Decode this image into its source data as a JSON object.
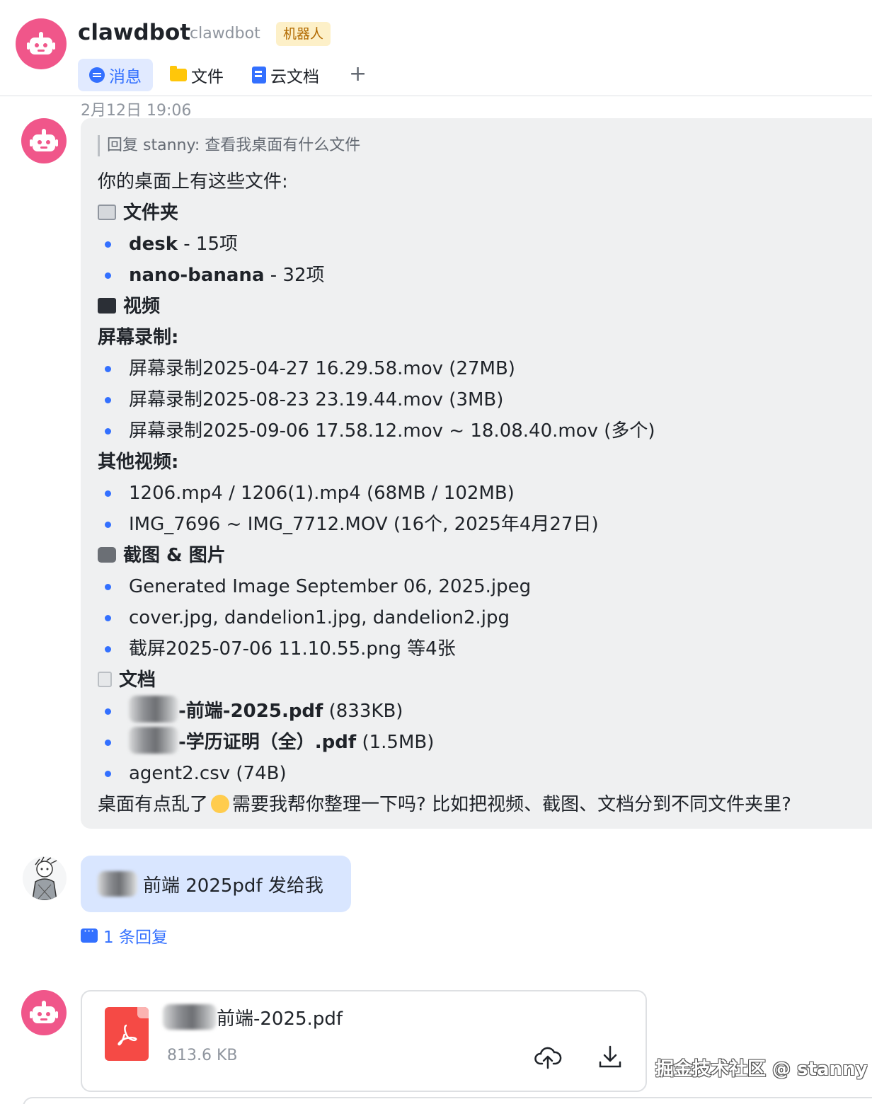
{
  "header": {
    "title": "clawdbot",
    "subtitle": "clawdbot",
    "tag": "机器人",
    "tabs": [
      {
        "label": "消息",
        "icon": "message-icon",
        "active": true
      },
      {
        "label": "文件",
        "icon": "folder-icon"
      },
      {
        "label": "云文档",
        "icon": "cloud-doc-icon"
      }
    ],
    "add_tab": "+"
  },
  "timestamp": "2月12日 19:06",
  "bot_message": {
    "quote": "回复 stanny: 查看我桌面有什么文件",
    "intro": "你的桌面上有这些文件:",
    "folders_heading": "文件夹",
    "folders": [
      {
        "name": "desk",
        "detail": " - 15项"
      },
      {
        "name": "nano-banana",
        "detail": " - 32项"
      }
    ],
    "videos_heading": "视频",
    "screen_rec_heading": "屏幕录制:",
    "screen_recordings": [
      "屏幕录制2025-04-27 16.29.58.mov (27MB)",
      "屏幕录制2025-08-23 23.19.44.mov (3MB)",
      "屏幕录制2025-09-06 17.58.12.mov ~ 18.08.40.mov (多个)"
    ],
    "other_videos_heading": "其他视频:",
    "other_videos": [
      "1206.mp4 / 1206(1).mp4 (68MB / 102MB)",
      "IMG_7696 ~ IMG_7712.MOV (16个, 2025年4月27日)"
    ],
    "images_heading": "截图 & 图片",
    "images": [
      "Generated Image September 06, 2025.jpeg",
      "cover.jpg, dandelion1.jpg, dandelion2.jpg",
      "截屏2025-07-06 11.10.55.png 等4张"
    ],
    "docs_heading": "文档",
    "docs": [
      {
        "name": "-前端-2025.pdf",
        "size": " (833KB)",
        "redacted": true
      },
      {
        "name": "-学历证明（全）.pdf",
        "size": " (1.5MB)",
        "redacted": true
      },
      {
        "name": "agent2.csv (74B)",
        "size": "",
        "redacted": false
      }
    ],
    "closing_a": "桌面有点乱了",
    "closing_b": "需要我帮你整理一下吗? 比如把视频、截图、文档分到不同文件夹里?"
  },
  "user_message": {
    "text": "前端 2025pdf 发给我",
    "reply_count": "1 条回复"
  },
  "file_message": {
    "file_name": "前端-2025.pdf",
    "file_size": "813.6 KB"
  },
  "watermark": "掘金技术社区 @ stanny",
  "colors": {
    "accent": "#3370ff",
    "bot_avatar": "#f0568a",
    "bubble_bg": "#eff0f1",
    "user_bubble_bg": "#d9e6ff",
    "pdf_red": "#f54a45"
  }
}
